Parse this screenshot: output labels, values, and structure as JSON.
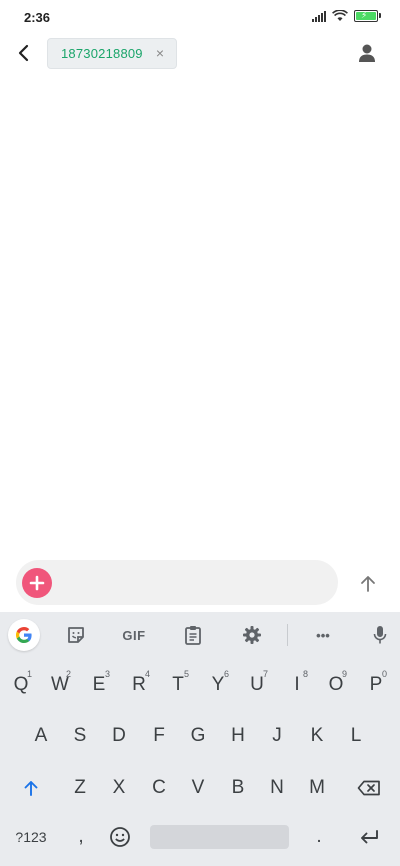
{
  "status_bar": {
    "time": "2:36"
  },
  "header": {
    "recipient": "18730218809",
    "chip_remove": "×"
  },
  "composer": {
    "placeholder": ""
  },
  "keyboard": {
    "toolbar": {
      "gif_label": "GIF",
      "more_label": "•••"
    },
    "row1": [
      {
        "label": "Q",
        "hint": "1"
      },
      {
        "label": "W",
        "hint": "2"
      },
      {
        "label": "E",
        "hint": "3"
      },
      {
        "label": "R",
        "hint": "4"
      },
      {
        "label": "T",
        "hint": "5"
      },
      {
        "label": "Y",
        "hint": "6"
      },
      {
        "label": "U",
        "hint": "7"
      },
      {
        "label": "I",
        "hint": "8"
      },
      {
        "label": "O",
        "hint": "9"
      },
      {
        "label": "P",
        "hint": "0"
      }
    ],
    "row2": [
      "A",
      "S",
      "D",
      "F",
      "G",
      "H",
      "J",
      "K",
      "L"
    ],
    "row3": [
      "Z",
      "X",
      "C",
      "V",
      "B",
      "N",
      "M"
    ],
    "symbols_label": "?123",
    "comma_label": ",",
    "period_label": "."
  },
  "colors": {
    "accent_green": "#1aa56a",
    "attach_pink": "#f0567b",
    "shift_blue": "#1a73e8"
  }
}
